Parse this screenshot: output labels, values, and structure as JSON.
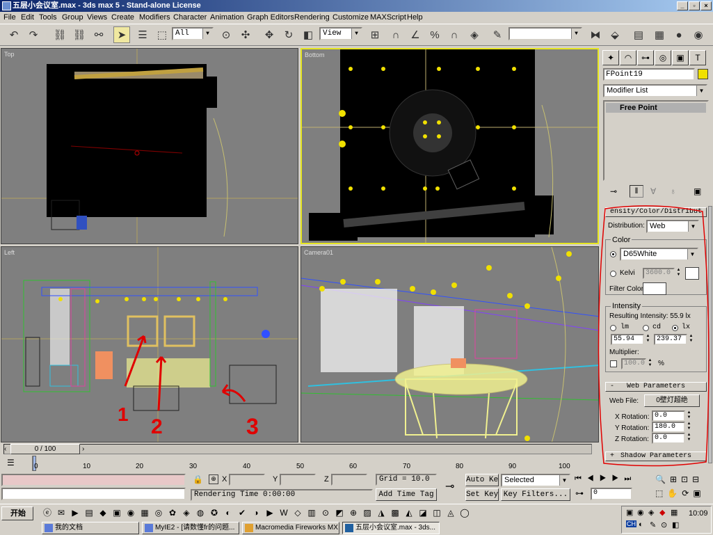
{
  "window": {
    "title": "五层小会议室.max - 3ds max 5 - Stand-alone License",
    "min": "_",
    "max": "▫",
    "close": "×"
  },
  "menu": [
    "File",
    "Edit",
    "Tools",
    "Group",
    "Views",
    "Create",
    "Modifiers",
    "Character",
    "Animation",
    "Graph Editors",
    "Rendering",
    "Customize",
    "MAXScript",
    "Help"
  ],
  "toolbar": {
    "selection_filter": "All",
    "ref_coord": "View",
    "named_selection": ""
  },
  "viewports": {
    "top": "Top",
    "bottom": "Bottom",
    "left": "Left",
    "camera": "Camera01"
  },
  "annotations": {
    "n1": "1",
    "n2": "2",
    "n3": "3"
  },
  "cmd": {
    "object_name": "FPoint19",
    "object_color": "#f0e000",
    "modifier_list": "Modifier List",
    "stack_item": "Free Point",
    "distribution_title": "ensity/Color/Distribut",
    "distribution_label": "Distribution:",
    "distribution_value": "Web",
    "color_group": "Color",
    "color_preset": "D65White",
    "kelvin_label": "Kelvi",
    "kelvin_value": "3600.0",
    "filter_color_label": "Filter Color:",
    "intensity_group": "Intensity",
    "resulting_intensity": "Resulting Intensity:  55.9 lx",
    "unit_lm": "lm",
    "unit_cd": "cd",
    "unit_lx": "lx",
    "intensity_value": "55.94",
    "distance_value": "239.37",
    "multiplier_label": "Multiplier:",
    "multiplier_value": "100.0",
    "percent": "%",
    "web_title": "Web Parameters",
    "web_minus": "-",
    "web_file_label": "Web File:",
    "web_file_value": "0壁灯超绝",
    "x_rot_label": "X Rotation:",
    "x_rot": "0.0",
    "y_rot_label": "Y Rotation:",
    "y_rot": "180.0",
    "z_rot_label": "Z Rotation:",
    "z_rot": "0.0",
    "shadow_title": "Shadow Parameters",
    "shadow_plus": "+"
  },
  "time": {
    "slider": "0 / 100",
    "ticks": [
      "0",
      "10",
      "20",
      "30",
      "40",
      "50",
      "60",
      "70",
      "80",
      "90",
      "100"
    ]
  },
  "status": {
    "x_label": "X",
    "y_label": "Y",
    "z_label": "Z",
    "grid": "Grid = 10.0",
    "auto_key": "Auto Key",
    "selected": "Selected",
    "rendering_time": "Rendering Time  0:00:00",
    "add_time_tag": "Add Time Tag",
    "set_key": "Set Key",
    "key_filters": "Key Filters...",
    "frame": "0"
  },
  "taskbar": {
    "start": "开始",
    "tasks": [
      "我的文档",
      "MyIE2 - [请数懂fr的问题...",
      "Macromedia Fireworks MX",
      "五层小会议室.max - 3ds..."
    ],
    "clock": "10:09",
    "ime": "CH"
  }
}
